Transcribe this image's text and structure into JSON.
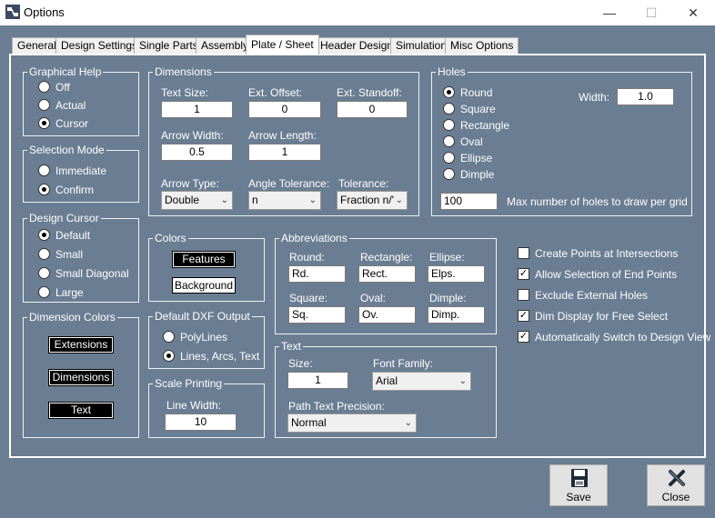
{
  "window": {
    "title": "Options",
    "minimize_icon": "—",
    "maximize_icon": "☐",
    "close_icon": "✕"
  },
  "tabs": [
    {
      "label": "General"
    },
    {
      "label": "Design Settings"
    },
    {
      "label": "Single Parts"
    },
    {
      "label": "Assembly"
    },
    {
      "label": "Plate / Sheet"
    },
    {
      "label": "Header Design"
    },
    {
      "label": "Simulation"
    },
    {
      "label": "Misc Options"
    }
  ],
  "active_tab": "Plate / Sheet",
  "graphical_help": {
    "title": "Graphical Help",
    "options": [
      "Off",
      "Actual",
      "Cursor"
    ],
    "selected": "Cursor"
  },
  "selection_mode": {
    "title": "Selection Mode",
    "options": [
      "Immediate",
      "Confirm"
    ],
    "selected": "Confirm"
  },
  "design_cursor": {
    "title": "Design Cursor",
    "options": [
      "Default",
      "Small",
      "Small Diagonal",
      "Large"
    ],
    "selected": "Default"
  },
  "dimension_colors": {
    "title": "Dimension Colors",
    "buttons": [
      "Extensions",
      "Dimensions",
      "Text"
    ]
  },
  "dimensions": {
    "title": "Dimensions",
    "text_size": {
      "label": "Text Size:",
      "value": "1"
    },
    "ext_offset": {
      "label": "Ext. Offset:",
      "value": "0"
    },
    "ext_standoff": {
      "label": "Ext. Standoff:",
      "value": "0"
    },
    "arrow_width": {
      "label": "Arrow Width:",
      "value": "0.5"
    },
    "arrow_length": {
      "label": "Arrow Length:",
      "value": "1"
    },
    "arrow_type": {
      "label": "Arrow Type:",
      "value": "Double"
    },
    "angle_tolerance": {
      "label": "Angle Tolerance:",
      "value": "n"
    },
    "tolerance": {
      "label": "Tolerance:",
      "value": "Fraction n/'"
    }
  },
  "holes": {
    "title": "Holes",
    "options": [
      "Round",
      "Square",
      "Rectangle",
      "Oval",
      "Ellipse",
      "Dimple"
    ],
    "selected": "Round",
    "width_label": "Width:",
    "width_value": "1.0",
    "max_value": "100",
    "max_label": "Max number of holes to draw per grid"
  },
  "colors": {
    "title": "Colors",
    "features": "Features",
    "background": "Background"
  },
  "dxf_output": {
    "title": "Default DXF Output",
    "options": [
      "PolyLines",
      "Lines, Arcs, Text"
    ],
    "selected": "Lines, Arcs, Text"
  },
  "scale_printing": {
    "title": "Scale Printing",
    "line_width_label": "Line Width:",
    "line_width_value": "10"
  },
  "abbreviations": {
    "title": "Abbreviations",
    "round": {
      "label": "Round:",
      "value": "Rd."
    },
    "rectangle": {
      "label": "Rectangle:",
      "value": "Rect."
    },
    "ellipse": {
      "label": "Ellipse:",
      "value": "Elps."
    },
    "square": {
      "label": "Square:",
      "value": "Sq."
    },
    "oval": {
      "label": "Oval:",
      "value": "Ov."
    },
    "dimple": {
      "label": "Dimple:",
      "value": "Dimp."
    }
  },
  "text_group": {
    "title": "Text",
    "size_label": "Size:",
    "size_value": "1",
    "font_family_label": "Font Family:",
    "font_family_value": "Arial",
    "path_precision_label": "Path Text Precision:",
    "path_precision_value": "Normal"
  },
  "checkboxes": [
    {
      "label": "Create Points at Intersections",
      "checked": false
    },
    {
      "label": "Allow Selection of End Points",
      "checked": true
    },
    {
      "label": "Exclude External Holes",
      "checked": false
    },
    {
      "label": "Dim Display for Free Select",
      "checked": true
    },
    {
      "label": "Automatically Switch to Design View",
      "checked": true
    }
  ],
  "check_mark": "✓",
  "buttons": {
    "save": "Save",
    "close": "Close"
  },
  "colors_theme": {
    "background": "#6a7d92",
    "title_bar": "#ffffff"
  }
}
